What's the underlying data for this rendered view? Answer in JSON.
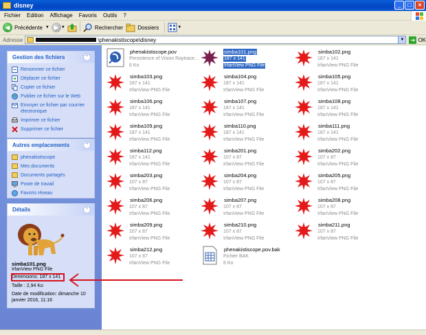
{
  "window": {
    "title": "disney"
  },
  "menu": [
    "Fichier",
    "Edition",
    "Affichage",
    "Favoris",
    "Outils",
    "?"
  ],
  "toolbar": {
    "back_label": "Précédente",
    "search_label": "Rechercher",
    "folders_label": "Dossiers"
  },
  "address": {
    "label": "Adresse",
    "path_suffix": "\\phenakistiscope\\disney",
    "go_label": "OK"
  },
  "tasks_panel": {
    "title": "Gestion des fichiers",
    "items": [
      "Renommer ce fichier",
      "Déplacer ce fichier",
      "Copier ce fichier",
      "Publier ce fichier sur le Web",
      "Envoyer ce fichier par courrier électronique",
      "Imprimer ce fichier",
      "Supprimer ce fichier"
    ]
  },
  "places_panel": {
    "title": "Autres emplacements",
    "items": [
      "phenakistiscope",
      "Mes documents",
      "Documents partagés",
      "Poste de travail",
      "Favoris réseau"
    ]
  },
  "details_panel": {
    "title": "Détails",
    "name": "simba101.png",
    "type": "IrfanView PNG File",
    "dimensions": "Dimensions: 187 x 141",
    "size": "Taille : 2,94 Ko",
    "modified": "Date de modification: dimanche 10 janvier 2016, 11:16"
  },
  "files": [
    {
      "name": "phenakistiscope.pov",
      "line2": "Persistence of Vision Raytrace...",
      "line3": "6 Ko",
      "kind": "pov"
    },
    {
      "name": "simba101.png",
      "line2": "187 x 141",
      "line3": "IrfanView PNG File",
      "kind": "lion",
      "selected": true
    },
    {
      "name": "simba102.png",
      "line2": "187 x 141",
      "line3": "IrfanView PNG File",
      "kind": "splat"
    },
    {
      "name": "simba103.png",
      "line2": "187 x 141",
      "line3": "IrfanView PNG File",
      "kind": "splat"
    },
    {
      "name": "simba104.png",
      "line2": "187 x 141",
      "line3": "IrfanView PNG File",
      "kind": "splat"
    },
    {
      "name": "simba105.png",
      "line2": "187 x 141",
      "line3": "IrfanView PNG File",
      "kind": "splat"
    },
    {
      "name": "simba106.png",
      "line2": "187 x 141",
      "line3": "IrfanView PNG File",
      "kind": "splat"
    },
    {
      "name": "simba107.png",
      "line2": "187 x 141",
      "line3": "IrfanView PNG File",
      "kind": "splat"
    },
    {
      "name": "simba108.png",
      "line2": "187 x 141",
      "line3": "IrfanView PNG File",
      "kind": "splat"
    },
    {
      "name": "simba109.png",
      "line2": "187 x 141",
      "line3": "IrfanView PNG File",
      "kind": "splat"
    },
    {
      "name": "simba110.png",
      "line2": "187 x 141",
      "line3": "IrfanView PNG File",
      "kind": "splat"
    },
    {
      "name": "simba111.png",
      "line2": "187 x 141",
      "line3": "IrfanView PNG File",
      "kind": "splat"
    },
    {
      "name": "simba112.png",
      "line2": "187 x 141",
      "line3": "IrfanView PNG File",
      "kind": "splat"
    },
    {
      "name": "simba201.png",
      "line2": "107 x 87",
      "line3": "IrfanView PNG File",
      "kind": "splat"
    },
    {
      "name": "simba202.png",
      "line2": "107 x 87",
      "line3": "IrfanView PNG File",
      "kind": "splat"
    },
    {
      "name": "simba203.png",
      "line2": "107 x 87",
      "line3": "IrfanView PNG File",
      "kind": "splat"
    },
    {
      "name": "simba204.png",
      "line2": "107 x 87",
      "line3": "IrfanView PNG File",
      "kind": "splat"
    },
    {
      "name": "simba205.png",
      "line2": "107 x 87",
      "line3": "IrfanView PNG File",
      "kind": "splat"
    },
    {
      "name": "simba206.png",
      "line2": "107 x 87",
      "line3": "IrfanView PNG File",
      "kind": "splat"
    },
    {
      "name": "simba207.png",
      "line2": "107 x 87",
      "line3": "IrfanView PNG File",
      "kind": "splat"
    },
    {
      "name": "simba208.png",
      "line2": "107 x 87",
      "line3": "IrfanView PNG File",
      "kind": "splat"
    },
    {
      "name": "simba209.png",
      "line2": "107 x 87",
      "line3": "IrfanView PNG File",
      "kind": "splat"
    },
    {
      "name": "simba210.png",
      "line2": "107 x 87",
      "line3": "IrfanView PNG File",
      "kind": "splat"
    },
    {
      "name": "simba211.png",
      "line2": "107 x 87",
      "line3": "IrfanView PNG File",
      "kind": "splat"
    },
    {
      "name": "simba212.png",
      "line2": "107 x 87",
      "line3": "IrfanView PNG File",
      "kind": "splat"
    },
    {
      "name": "phenakistiscope.pov.bak",
      "line2": "Fichier BAK",
      "line3": "6 Ko",
      "kind": "bak"
    }
  ]
}
